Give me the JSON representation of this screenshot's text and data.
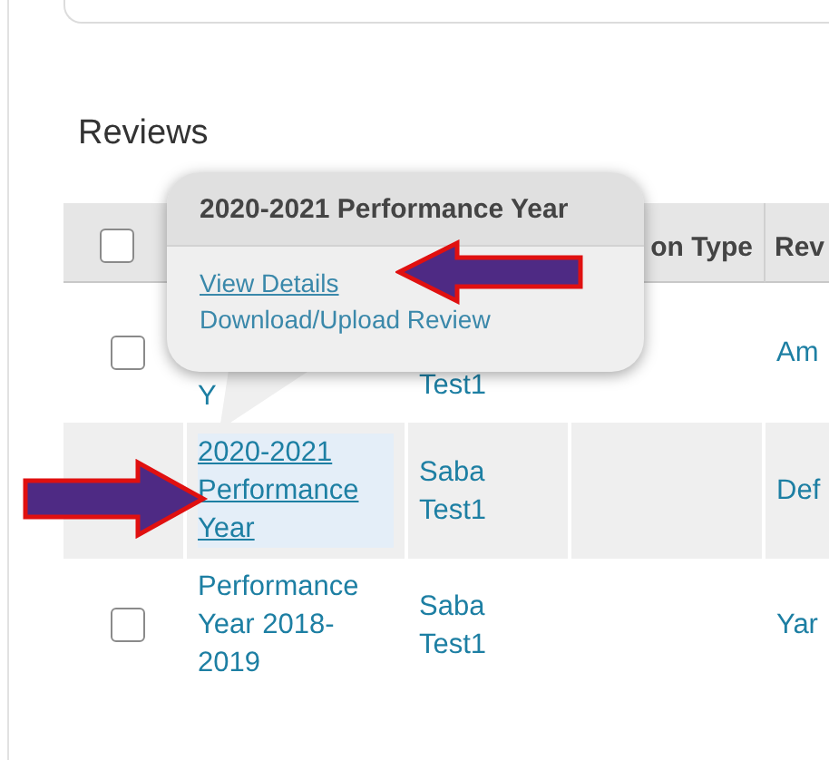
{
  "section_title": "Reviews",
  "table": {
    "header_checkbox": {
      "checked": false
    },
    "columns": [
      {
        "label": "on Type"
      },
      {
        "label": "Rev"
      }
    ],
    "rows": [
      {
        "checked": false,
        "selected": false,
        "name": "Y",
        "reviewer": "Test1",
        "column_5": "Am"
      },
      {
        "selected": true,
        "name": "2020-2021 Performance Year",
        "reviewer": "Saba Test1",
        "column_5": "Def"
      },
      {
        "checked": false,
        "selected": false,
        "name": "Performance Year 2018-2019",
        "reviewer": "Saba Test1",
        "column_5": "Yar"
      }
    ]
  },
  "popup": {
    "title": "2020-2021 Performance Year",
    "links": [
      {
        "label": "View Details",
        "hovered": true
      },
      {
        "label": "Download/Upload Review",
        "hovered": false
      }
    ]
  },
  "annotations": [
    {
      "kind": "left-arrow"
    },
    {
      "kind": "right-arrow"
    }
  ]
}
